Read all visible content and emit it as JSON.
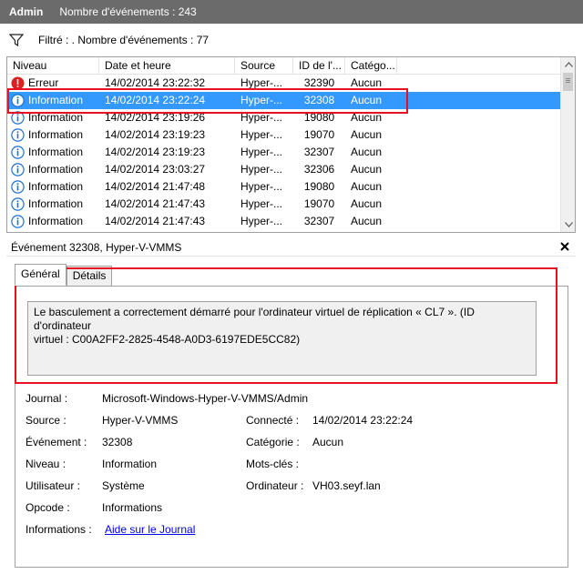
{
  "title": {
    "app": "Admin",
    "count": "Nombre d'événements : 243"
  },
  "filter": {
    "text": "Filtré : . Nombre d'événements : 77"
  },
  "columns": [
    "Niveau",
    "Date et heure",
    "Source",
    "ID de l'...",
    "Catégo..."
  ],
  "rows": [
    {
      "level": "Erreur",
      "datetime": "14/02/2014 23:22:32",
      "source": "Hyper-...",
      "id": "32390",
      "category": "Aucun",
      "icon": "error-icon"
    },
    {
      "level": "Information",
      "datetime": "14/02/2014 23:22:24",
      "source": "Hyper-...",
      "id": "32308",
      "category": "Aucun",
      "icon": "info-icon",
      "selected": true
    },
    {
      "level": "Information",
      "datetime": "14/02/2014 23:19:26",
      "source": "Hyper-...",
      "id": "19080",
      "category": "Aucun",
      "icon": "info-icon"
    },
    {
      "level": "Information",
      "datetime": "14/02/2014 23:19:23",
      "source": "Hyper-...",
      "id": "19070",
      "category": "Aucun",
      "icon": "info-icon"
    },
    {
      "level": "Information",
      "datetime": "14/02/2014 23:19:23",
      "source": "Hyper-...",
      "id": "32307",
      "category": "Aucun",
      "icon": "info-icon"
    },
    {
      "level": "Information",
      "datetime": "14/02/2014 23:03:27",
      "source": "Hyper-...",
      "id": "32306",
      "category": "Aucun",
      "icon": "info-icon"
    },
    {
      "level": "Information",
      "datetime": "14/02/2014 21:47:48",
      "source": "Hyper-...",
      "id": "19080",
      "category": "Aucun",
      "icon": "info-icon"
    },
    {
      "level": "Information",
      "datetime": "14/02/2014 21:47:43",
      "source": "Hyper-...",
      "id": "19070",
      "category": "Aucun",
      "icon": "info-icon"
    },
    {
      "level": "Information",
      "datetime": "14/02/2014 21:47:43",
      "source": "Hyper-...",
      "id": "32307",
      "category": "Aucun",
      "icon": "info-icon"
    }
  ],
  "detail": {
    "header": "Événement 32308, Hyper-V-VMMS",
    "tabs": [
      "Général",
      "Détails"
    ],
    "message_line1": "Le basculement a correctement démarré pour l'ordinateur virtuel de réplication « CL7 ». (ID d'ordinateur",
    "message_line2": "virtuel : C00A2FF2-2825-4548-A0D3-6197EDE5CC82)",
    "props": {
      "journal_label": "Journal :",
      "journal_value": "Microsoft-Windows-Hyper-V-VMMS/Admin",
      "source_label": "Source :",
      "source_value": "Hyper-V-VMMS",
      "connecte_label": "Connecté :",
      "connecte_value": "14/02/2014 23:22:24",
      "evenement_label": "Événement :",
      "evenement_value": "32308",
      "categorie_label": "Catégorie :",
      "categorie_value": "Aucun",
      "niveau_label": "Niveau :",
      "niveau_value": "Information",
      "motscles_label": "Mots-clés :",
      "motscles_value": "",
      "utilisateur_label": "Utilisateur :",
      "utilisateur_value": "Système",
      "ordinateur_label": "Ordinateur :",
      "ordinateur_value": "VH03.seyf.lan",
      "opcode_label": "Opcode :",
      "opcode_value": "Informations",
      "informations_label": "Informations :",
      "informations_link": "Aide sur le Journal"
    }
  },
  "colors": {
    "titlebar": "#6b6b6b",
    "selection": "#3399ff",
    "highlight": "#e81123",
    "info": "#1e6fd0",
    "error": "#d9221c",
    "link": "#0000ee"
  }
}
